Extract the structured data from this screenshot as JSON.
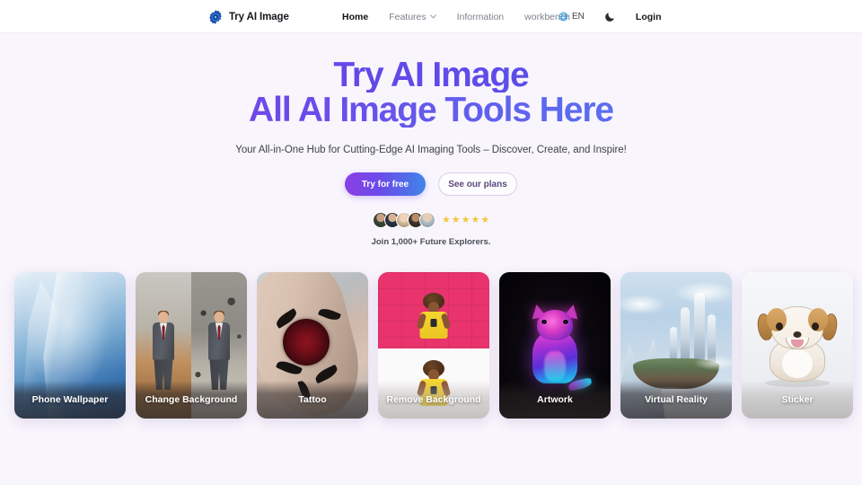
{
  "navbar": {
    "brand": {
      "name": "Try AI Image",
      "icon": "gear-logo-icon"
    },
    "links": [
      {
        "label": "Home",
        "active": true
      },
      {
        "label": "Features",
        "has_dropdown": true
      },
      {
        "label": "Information"
      },
      {
        "label": "workbench"
      }
    ],
    "language": {
      "code": "EN",
      "icon": "globe-icon"
    },
    "theme_toggle_icon": "moon-icon",
    "login_label": "Login"
  },
  "hero": {
    "title_line1": "Try AI Image",
    "title_line2": "All AI Image Tools Here",
    "subtitle": "Your All-in-One Hub for Cutting-Edge AI Imaging Tools – Discover, Create, and Inspire!",
    "primary_cta": "Try for free",
    "secondary_cta": "See our plans",
    "avatar_count": 5,
    "star_count": 5,
    "star_glyph": "★",
    "join_text": "Join 1,000+ Future Explorers."
  },
  "cards": [
    {
      "label": "Phone Wallpaper",
      "art": "icy-blue-cliff"
    },
    {
      "label": "Change Background",
      "art": "split-portrait-suit"
    },
    {
      "label": "Tattoo",
      "art": "rose-tattoo-arm"
    },
    {
      "label": "Remove Background",
      "art": "woman-pink-wall"
    },
    {
      "label": "Artwork",
      "art": "neon-cat"
    },
    {
      "label": "Virtual Reality",
      "art": "floating-island-castle"
    },
    {
      "label": "Sticker",
      "art": "cartoon-puppy"
    }
  ],
  "colors": {
    "page_background": "#f9f5fd",
    "navbar_background": "#ffffff",
    "gradient_start": "#8a3fe3",
    "gradient_mid": "#6a4bea",
    "gradient_end": "#3f86e8",
    "star": "#f3c63f",
    "text_primary": "#15171c",
    "text_muted": "#7c818c"
  }
}
